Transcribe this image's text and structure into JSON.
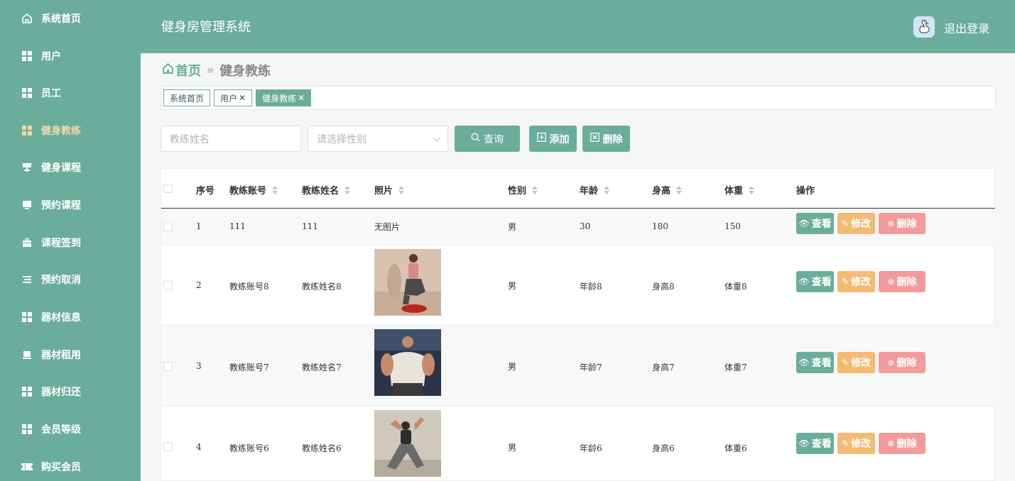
{
  "sidebar": {
    "items": [
      {
        "label": "系统首页",
        "icon": "home-icon"
      },
      {
        "label": "用户",
        "icon": "grid-icon"
      },
      {
        "label": "员工",
        "icon": "grid-icon"
      },
      {
        "label": "健身教练",
        "icon": "grid-icon",
        "active": true
      },
      {
        "label": "健身课程",
        "icon": "signpost-icon"
      },
      {
        "label": "预约课程",
        "icon": "monitor-icon"
      },
      {
        "label": "课程签到",
        "icon": "briefcase-icon"
      },
      {
        "label": "预约取消",
        "icon": "list-icon"
      },
      {
        "label": "器材信息",
        "icon": "grid-icon"
      },
      {
        "label": "器材租用",
        "icon": "laptop-icon"
      },
      {
        "label": "器材归还",
        "icon": "grid-icon"
      },
      {
        "label": "会员等级",
        "icon": "grid-icon"
      },
      {
        "label": "购买会员",
        "icon": "ticket-icon"
      }
    ]
  },
  "header": {
    "title": "健身房管理系统",
    "logout": "退出登录"
  },
  "breadcrumb": {
    "home": "首页",
    "current": "健身教练"
  },
  "tags": [
    {
      "label": "系统首页",
      "closable": false,
      "active": false
    },
    {
      "label": "用户",
      "closable": true,
      "active": false
    },
    {
      "label": "健身教练",
      "closable": true,
      "active": true
    }
  ],
  "search": {
    "name_placeholder": "教练姓名",
    "sex_placeholder": "请选择性别",
    "query_label": "查询",
    "add_label": "添加",
    "delete_label": "删除"
  },
  "table": {
    "headers": {
      "index": "序号",
      "account": "教练账号",
      "name": "教练姓名",
      "photo": "照片",
      "sex": "性别",
      "age": "年龄",
      "height": "身高",
      "weight": "体重",
      "actions": "操作"
    },
    "rows": [
      {
        "index": "1",
        "account": "111",
        "name": "111",
        "photo_text": "无图片",
        "sex": "男",
        "age": "30",
        "height": "180",
        "weight": "150"
      },
      {
        "index": "2",
        "account": "教练账号8",
        "name": "教练姓名8",
        "photo_text": "",
        "sex": "男",
        "age": "年龄8",
        "height": "身高8",
        "weight": "体重8"
      },
      {
        "index": "3",
        "account": "教练账号7",
        "name": "教练姓名7",
        "photo_text": "",
        "sex": "男",
        "age": "年龄7",
        "height": "身高7",
        "weight": "体重7"
      },
      {
        "index": "4",
        "account": "教练账号6",
        "name": "教练姓名6",
        "photo_text": "",
        "sex": "男",
        "age": "年龄6",
        "height": "身高6",
        "weight": "体重6"
      }
    ],
    "action_labels": {
      "view": "查看",
      "edit": "修改",
      "delete": "删除"
    }
  },
  "colors": {
    "primary": "#6aad9a",
    "edit": "#f3bb72",
    "danger": "#f59a9a",
    "active_menu": "#f4d9a8"
  }
}
